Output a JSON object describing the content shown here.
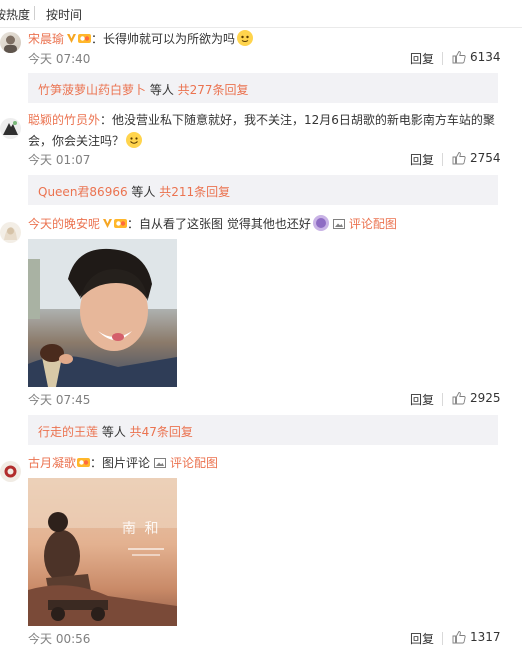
{
  "sort": {
    "hot": "按热度",
    "time": "按时间"
  },
  "comments": [
    {
      "name": "宋晨瑜",
      "text": "：长得帅就可以为所欲为吗",
      "time": "今天 07:40",
      "reply": "回复",
      "likes": "6134",
      "replies": {
        "name": "竹笋菠萝山药白萝卜",
        "mid": " 等人 ",
        "count": "共277条回复"
      }
    },
    {
      "name": "聪颖的竹员外",
      "text": "：他没营业私下随意就好，我不关注，12月6日胡歌的新电影南方车站的聚",
      "text2": "会，你会关注吗？",
      "time": "今天 01:07",
      "reply": "回复",
      "likes": "2754",
      "replies": {
        "name": "Queen君86966",
        "mid": " 等人 ",
        "count": "共211条回复"
      }
    },
    {
      "name": "今天的晚安呢",
      "text": "：自从看了这张图 觉得其他也还好",
      "view_pic": "评论配图",
      "time": "今天 07:45",
      "reply": "回复",
      "likes": "2925",
      "replies": {
        "name": "行走的王莲",
        "mid": " 等人 ",
        "count": "共47条回复"
      }
    },
    {
      "name": "古月凝歌",
      "text": "：图片评论",
      "view_pic": "评论配图",
      "time": "今天 00:56",
      "reply": "回复",
      "likes": "1317",
      "poster_text": "南 和"
    }
  ],
  "colors": {
    "link": "#eb7350",
    "muted": "#808080",
    "reply_bg": "#f2f2f5"
  }
}
